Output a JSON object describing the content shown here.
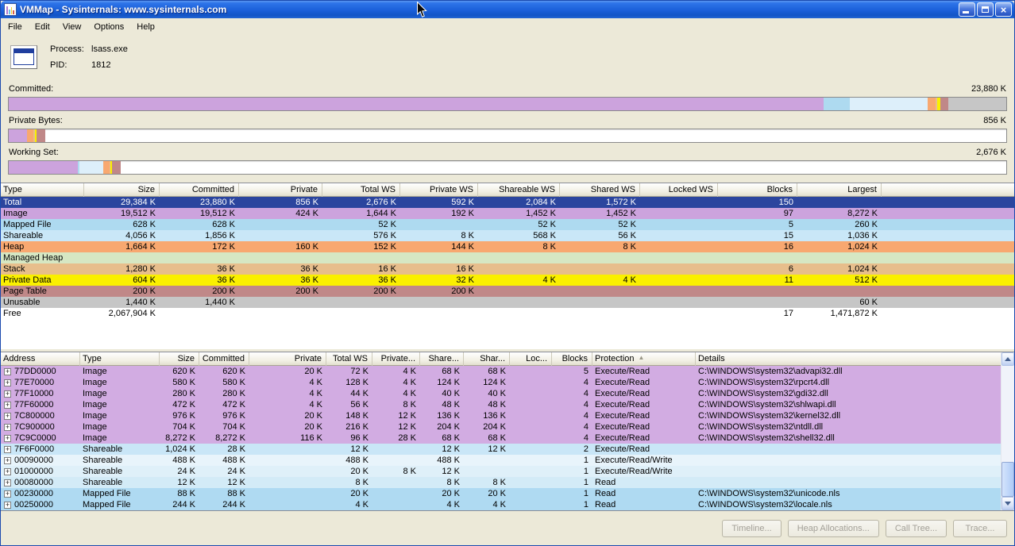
{
  "window": {
    "title": "VMMap - Sysinternals: www.sysinternals.com"
  },
  "menu": {
    "items": [
      "File",
      "Edit",
      "View",
      "Options",
      "Help"
    ]
  },
  "process": {
    "process_label": "Process:",
    "process_name": "lsass.exe",
    "pid_label": "PID:",
    "pid": "1812"
  },
  "palette": {
    "image": "#CCA3DD",
    "mapped_file": "#AEDAF0",
    "shareable": "#C9E7F7",
    "heap": "#F8A870",
    "managed_heap": "#D6E7C3",
    "stack": "#E7BE8C",
    "private_data": "#FAF000",
    "page_table": "#C08888",
    "unusable": "#C6C6C6",
    "free": "#FFFFFF",
    "selection": "#2B459E"
  },
  "bars": [
    {
      "label": "Committed:",
      "value": "23,880 K",
      "segments": [
        {
          "color": "#CCA3DD",
          "pct": 81.7
        },
        {
          "color": "#AEDAF0",
          "pct": 2.6
        },
        {
          "color": "#DDEFFA",
          "pct": 7.8
        },
        {
          "color": "#F8A870",
          "pct": 0.8
        },
        {
          "color": "#E7BE8C",
          "pct": 0.2
        },
        {
          "color": "#FAF000",
          "pct": 0.3
        },
        {
          "color": "#C08888",
          "pct": 0.8
        },
        {
          "color": "#C6C6C6",
          "pct": 5.8
        }
      ]
    },
    {
      "label": "Private Bytes:",
      "value": "856 K",
      "segments": [
        {
          "color": "#CCA3DD",
          "pct": 1.8
        },
        {
          "color": "#F8A870",
          "pct": 0.7
        },
        {
          "color": "#E7BE8C",
          "pct": 0.15
        },
        {
          "color": "#FAF000",
          "pct": 0.15
        },
        {
          "color": "#C08888",
          "pct": 0.85
        }
      ]
    },
    {
      "label": "Working Set:",
      "value": "2,676 K",
      "segments": [
        {
          "color": "#CCA3DD",
          "pct": 6.9
        },
        {
          "color": "#AEDAF0",
          "pct": 0.2
        },
        {
          "color": "#DDEFFA",
          "pct": 2.4
        },
        {
          "color": "#F8A870",
          "pct": 0.65
        },
        {
          "color": "#E7BE8C",
          "pct": 0.07
        },
        {
          "color": "#FAF000",
          "pct": 0.15
        },
        {
          "color": "#C08888",
          "pct": 0.85
        }
      ]
    }
  ],
  "summary_table": {
    "columns": [
      "Type",
      "Size",
      "Committed",
      "Private",
      "Total WS",
      "Private WS",
      "Shareable WS",
      "Shared WS",
      "Locked WS",
      "Blocks",
      "Largest"
    ],
    "rows": [
      {
        "type": "Total",
        "color": "#2B459E",
        "text_color": "#FFFFFF",
        "cells": [
          "29,384 K",
          "23,880 K",
          "856 K",
          "2,676 K",
          "592 K",
          "2,084 K",
          "1,572 K",
          "",
          "150",
          ""
        ]
      },
      {
        "type": "Image",
        "color": "#CCA3DD",
        "cells": [
          "19,512 K",
          "19,512 K",
          "424 K",
          "1,644 K",
          "192 K",
          "1,452 K",
          "1,452 K",
          "",
          "97",
          "8,272 K"
        ]
      },
      {
        "type": "Mapped File",
        "color": "#AEDAF0",
        "cells": [
          "628 K",
          "628 K",
          "",
          "52 K",
          "",
          "52 K",
          "52 K",
          "",
          "5",
          "260 K"
        ]
      },
      {
        "type": "Shareable",
        "color": "#C9E7F7",
        "cells": [
          "4,056 K",
          "1,856 K",
          "",
          "576 K",
          "8 K",
          "568 K",
          "56 K",
          "",
          "15",
          "1,036 K"
        ]
      },
      {
        "type": "Heap",
        "color": "#F8A870",
        "cells": [
          "1,664 K",
          "172 K",
          "160 K",
          "152 K",
          "144 K",
          "8 K",
          "8 K",
          "",
          "16",
          "1,024 K"
        ]
      },
      {
        "type": "Managed Heap",
        "color": "#D6E7C3",
        "cells": [
          "",
          "",
          "",
          "",
          "",
          "",
          "",
          "",
          "",
          ""
        ]
      },
      {
        "type": "Stack",
        "color": "#E7BE8C",
        "cells": [
          "1,280 K",
          "36 K",
          "36 K",
          "16 K",
          "16 K",
          "",
          "",
          "",
          "6",
          "1,024 K"
        ]
      },
      {
        "type": "Private Data",
        "color": "#FAF000",
        "cells": [
          "604 K",
          "36 K",
          "36 K",
          "36 K",
          "32 K",
          "4 K",
          "4 K",
          "",
          "11",
          "512 K"
        ]
      },
      {
        "type": "Page Table",
        "color": "#C08888",
        "cells": [
          "200 K",
          "200 K",
          "200 K",
          "200 K",
          "200 K",
          "",
          "",
          "",
          "",
          ""
        ]
      },
      {
        "type": "Unusable",
        "color": "#C6C6C6",
        "cells": [
          "1,440 K",
          "1,440 K",
          "",
          "",
          "",
          "",
          "",
          "",
          "",
          "60 K"
        ]
      },
      {
        "type": "Free",
        "color": "#FFFFFF",
        "cells": [
          "2,067,904 K",
          "",
          "",
          "",
          "",
          "",
          "",
          "",
          "17",
          "1,471,872 K"
        ]
      }
    ]
  },
  "detail_table": {
    "columns": [
      "Address",
      "Type",
      "Size",
      "Committed",
      "Private",
      "Total WS",
      "Private...",
      "Share...",
      "Shar...",
      "Loc...",
      "Blocks",
      "Protection",
      "Details"
    ],
    "sort_column": "Protection",
    "rows": [
      {
        "address": "77DD0000",
        "color": "#D2ACE2",
        "cells": [
          "Image",
          "620 K",
          "620 K",
          "20 K",
          "72 K",
          "4 K",
          "68 K",
          "68 K",
          "",
          "5",
          "Execute/Read",
          "C:\\WINDOWS\\system32\\advapi32.dll"
        ]
      },
      {
        "address": "77E70000",
        "color": "#D2ACE2",
        "cells": [
          "Image",
          "580 K",
          "580 K",
          "4 K",
          "128 K",
          "4 K",
          "124 K",
          "124 K",
          "",
          "4",
          "Execute/Read",
          "C:\\WINDOWS\\system32\\rpcrt4.dll"
        ]
      },
      {
        "address": "77F10000",
        "color": "#D2ACE2",
        "cells": [
          "Image",
          "280 K",
          "280 K",
          "4 K",
          "44 K",
          "4 K",
          "40 K",
          "40 K",
          "",
          "4",
          "Execute/Read",
          "C:\\WINDOWS\\system32\\gdi32.dll"
        ]
      },
      {
        "address": "77F60000",
        "color": "#D2ACE2",
        "cells": [
          "Image",
          "472 K",
          "472 K",
          "4 K",
          "56 K",
          "8 K",
          "48 K",
          "48 K",
          "",
          "4",
          "Execute/Read",
          "C:\\WINDOWS\\system32\\shlwapi.dll"
        ]
      },
      {
        "address": "7C800000",
        "color": "#D2ACE2",
        "cells": [
          "Image",
          "976 K",
          "976 K",
          "20 K",
          "148 K",
          "12 K",
          "136 K",
          "136 K",
          "",
          "4",
          "Execute/Read",
          "C:\\WINDOWS\\system32\\kernel32.dll"
        ]
      },
      {
        "address": "7C900000",
        "color": "#D2ACE2",
        "cells": [
          "Image",
          "704 K",
          "704 K",
          "20 K",
          "216 K",
          "12 K",
          "204 K",
          "204 K",
          "",
          "4",
          "Execute/Read",
          "C:\\WINDOWS\\system32\\ntdll.dll"
        ]
      },
      {
        "address": "7C9C0000",
        "color": "#D2ACE2",
        "cells": [
          "Image",
          "8,272 K",
          "8,272 K",
          "116 K",
          "96 K",
          "28 K",
          "68 K",
          "68 K",
          "",
          "4",
          "Execute/Read",
          "C:\\WINDOWS\\system32\\shell32.dll"
        ]
      },
      {
        "address": "7F6F0000",
        "color": "#C9E6F7",
        "cells": [
          "Shareable",
          "1,024 K",
          "28 K",
          "",
          "12 K",
          "",
          "12 K",
          "12 K",
          "",
          "2",
          "Execute/Read",
          ""
        ]
      },
      {
        "address": "00090000",
        "color": "#E8F4FB",
        "cells": [
          "Shareable",
          "488 K",
          "488 K",
          "",
          "488 K",
          "",
          "488 K",
          "",
          "",
          "1",
          "Execute/Read/Write",
          ""
        ]
      },
      {
        "address": "01000000",
        "color": "#DFF0F9",
        "cells": [
          "Shareable",
          "24 K",
          "24 K",
          "",
          "20 K",
          "8 K",
          "12 K",
          "",
          "",
          "1",
          "Execute/Read/Write",
          ""
        ]
      },
      {
        "address": "00080000",
        "color": "#D3EBF7",
        "cells": [
          "Shareable",
          "12 K",
          "12 K",
          "",
          "8 K",
          "",
          "8 K",
          "8 K",
          "",
          "1",
          "Read",
          ""
        ]
      },
      {
        "address": "00230000",
        "color": "#AFDAF2",
        "cells": [
          "Mapped File",
          "88 K",
          "88 K",
          "",
          "20 K",
          "",
          "20 K",
          "20 K",
          "",
          "1",
          "Read",
          "C:\\WINDOWS\\system32\\unicode.nls"
        ]
      },
      {
        "address": "00250000",
        "color": "#AFDAF2",
        "cells": [
          "Mapped File",
          "244 K",
          "244 K",
          "",
          "4 K",
          "",
          "4 K",
          "4 K",
          "",
          "1",
          "Read",
          "C:\\WINDOWS\\system32\\locale.nls"
        ]
      }
    ]
  },
  "footer": {
    "buttons": [
      {
        "label": "Timeline...",
        "enabled": false
      },
      {
        "label": "Heap Allocations...",
        "enabled": false
      },
      {
        "label": "Call Tree...",
        "enabled": false
      },
      {
        "label": "Trace...",
        "enabled": false
      }
    ]
  }
}
